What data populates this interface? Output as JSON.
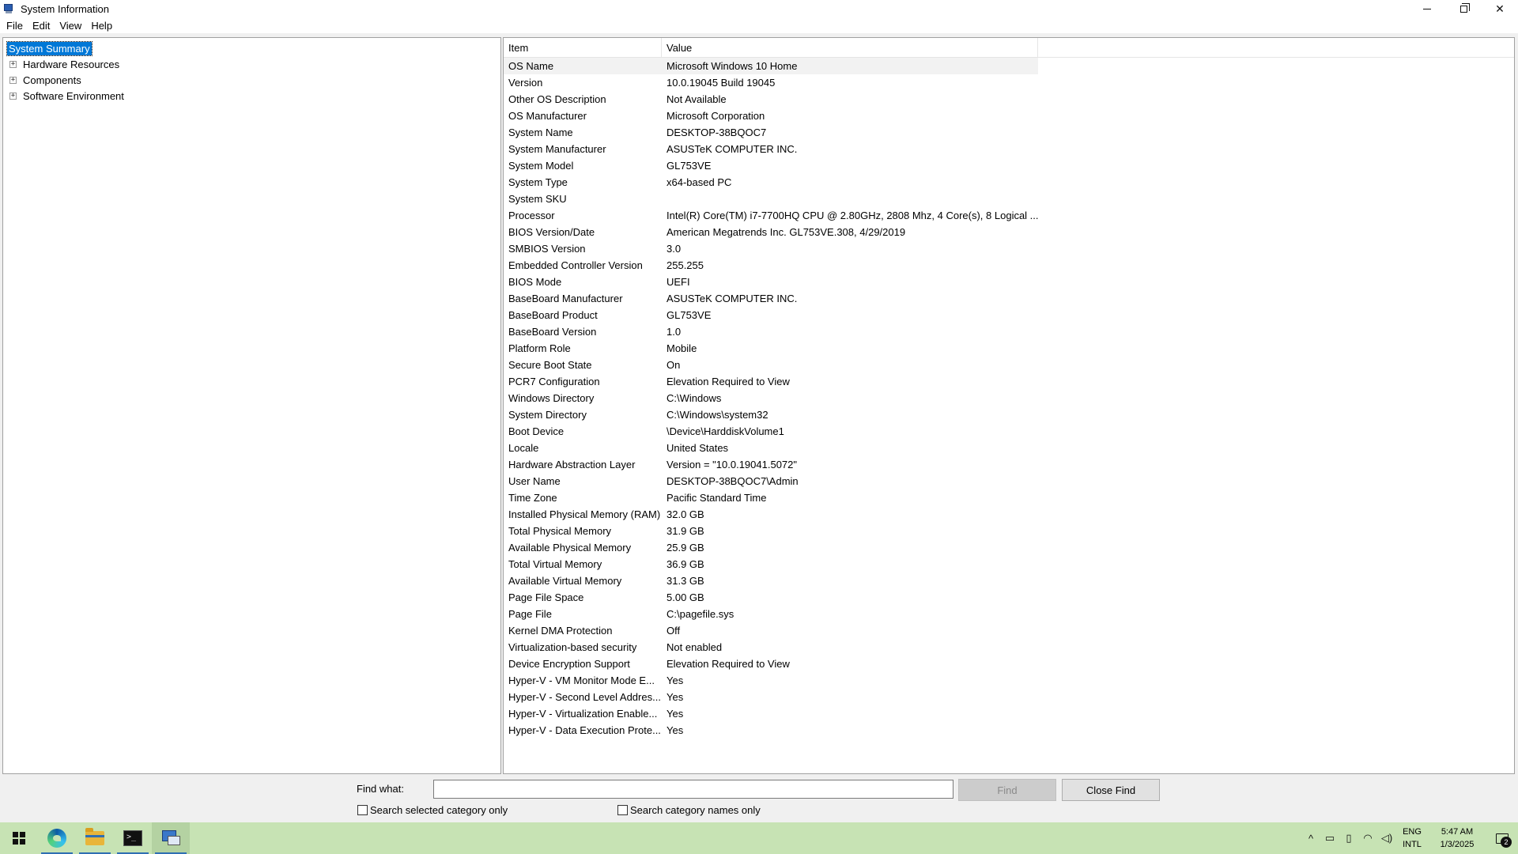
{
  "window": {
    "title": "System Information"
  },
  "menu": [
    "File",
    "Edit",
    "View",
    "Help"
  ],
  "tree": {
    "root": "System Summary",
    "children": [
      "Hardware Resources",
      "Components",
      "Software Environment"
    ]
  },
  "table": {
    "headers": {
      "item": "Item",
      "value": "Value"
    },
    "rows": [
      {
        "item": "OS Name",
        "value": "Microsoft Windows 10 Home"
      },
      {
        "item": "Version",
        "value": "10.0.19045 Build 19045"
      },
      {
        "item": "Other OS Description",
        "value": "Not Available"
      },
      {
        "item": "OS Manufacturer",
        "value": "Microsoft Corporation"
      },
      {
        "item": "System Name",
        "value": "DESKTOP-38BQOC7"
      },
      {
        "item": "System Manufacturer",
        "value": "ASUSTeK COMPUTER INC."
      },
      {
        "item": "System Model",
        "value": "GL753VE"
      },
      {
        "item": "System Type",
        "value": "x64-based PC"
      },
      {
        "item": "System SKU",
        "value": ""
      },
      {
        "item": "Processor",
        "value": "Intel(R) Core(TM) i7-7700HQ CPU @ 2.80GHz, 2808 Mhz, 4 Core(s), 8 Logical ..."
      },
      {
        "item": "BIOS Version/Date",
        "value": "American Megatrends Inc. GL753VE.308, 4/29/2019"
      },
      {
        "item": "SMBIOS Version",
        "value": "3.0"
      },
      {
        "item": "Embedded Controller Version",
        "value": "255.255"
      },
      {
        "item": "BIOS Mode",
        "value": "UEFI"
      },
      {
        "item": "BaseBoard Manufacturer",
        "value": "ASUSTeK COMPUTER INC."
      },
      {
        "item": "BaseBoard Product",
        "value": "GL753VE"
      },
      {
        "item": "BaseBoard Version",
        "value": "1.0"
      },
      {
        "item": "Platform Role",
        "value": "Mobile"
      },
      {
        "item": "Secure Boot State",
        "value": "On"
      },
      {
        "item": "PCR7 Configuration",
        "value": "Elevation Required to View"
      },
      {
        "item": "Windows Directory",
        "value": "C:\\Windows"
      },
      {
        "item": "System Directory",
        "value": "C:\\Windows\\system32"
      },
      {
        "item": "Boot Device",
        "value": "\\Device\\HarddiskVolume1"
      },
      {
        "item": "Locale",
        "value": "United States"
      },
      {
        "item": "Hardware Abstraction Layer",
        "value": "Version = \"10.0.19041.5072\""
      },
      {
        "item": "User Name",
        "value": "DESKTOP-38BQOC7\\Admin"
      },
      {
        "item": "Time Zone",
        "value": "Pacific Standard Time"
      },
      {
        "item": "Installed Physical Memory (RAM)",
        "value": "32.0 GB"
      },
      {
        "item": "Total Physical Memory",
        "value": "31.9 GB"
      },
      {
        "item": "Available Physical Memory",
        "value": "25.9 GB"
      },
      {
        "item": "Total Virtual Memory",
        "value": "36.9 GB"
      },
      {
        "item": "Available Virtual Memory",
        "value": "31.3 GB"
      },
      {
        "item": "Page File Space",
        "value": "5.00 GB"
      },
      {
        "item": "Page File",
        "value": "C:\\pagefile.sys"
      },
      {
        "item": "Kernel DMA Protection",
        "value": "Off"
      },
      {
        "item": "Virtualization-based security",
        "value": "Not enabled"
      },
      {
        "item": "Device Encryption Support",
        "value": "Elevation Required to View"
      },
      {
        "item": "Hyper-V - VM Monitor Mode E...",
        "value": "Yes"
      },
      {
        "item": "Hyper-V - Second Level Addres...",
        "value": "Yes"
      },
      {
        "item": "Hyper-V - Virtualization Enable...",
        "value": "Yes"
      },
      {
        "item": "Hyper-V - Data Execution Prote...",
        "value": "Yes"
      }
    ]
  },
  "find": {
    "label": "Find what:",
    "value": "",
    "find_button": "Find",
    "close_button": "Close Find",
    "check_selected": "Search selected category only",
    "check_names": "Search category names only"
  },
  "taskbar": {
    "apps": [
      "start-icon",
      "edge-icon",
      "file-explorer-icon",
      "terminal-icon",
      "system-information-icon"
    ],
    "tray": {
      "lang_line1": "ENG",
      "lang_line2": "INTL",
      "time": "5:47 AM",
      "date": "1/3/2025",
      "notification_count": "2"
    }
  },
  "colors": {
    "selection": "#0078d7",
    "taskbar": "#c7e3b4"
  }
}
